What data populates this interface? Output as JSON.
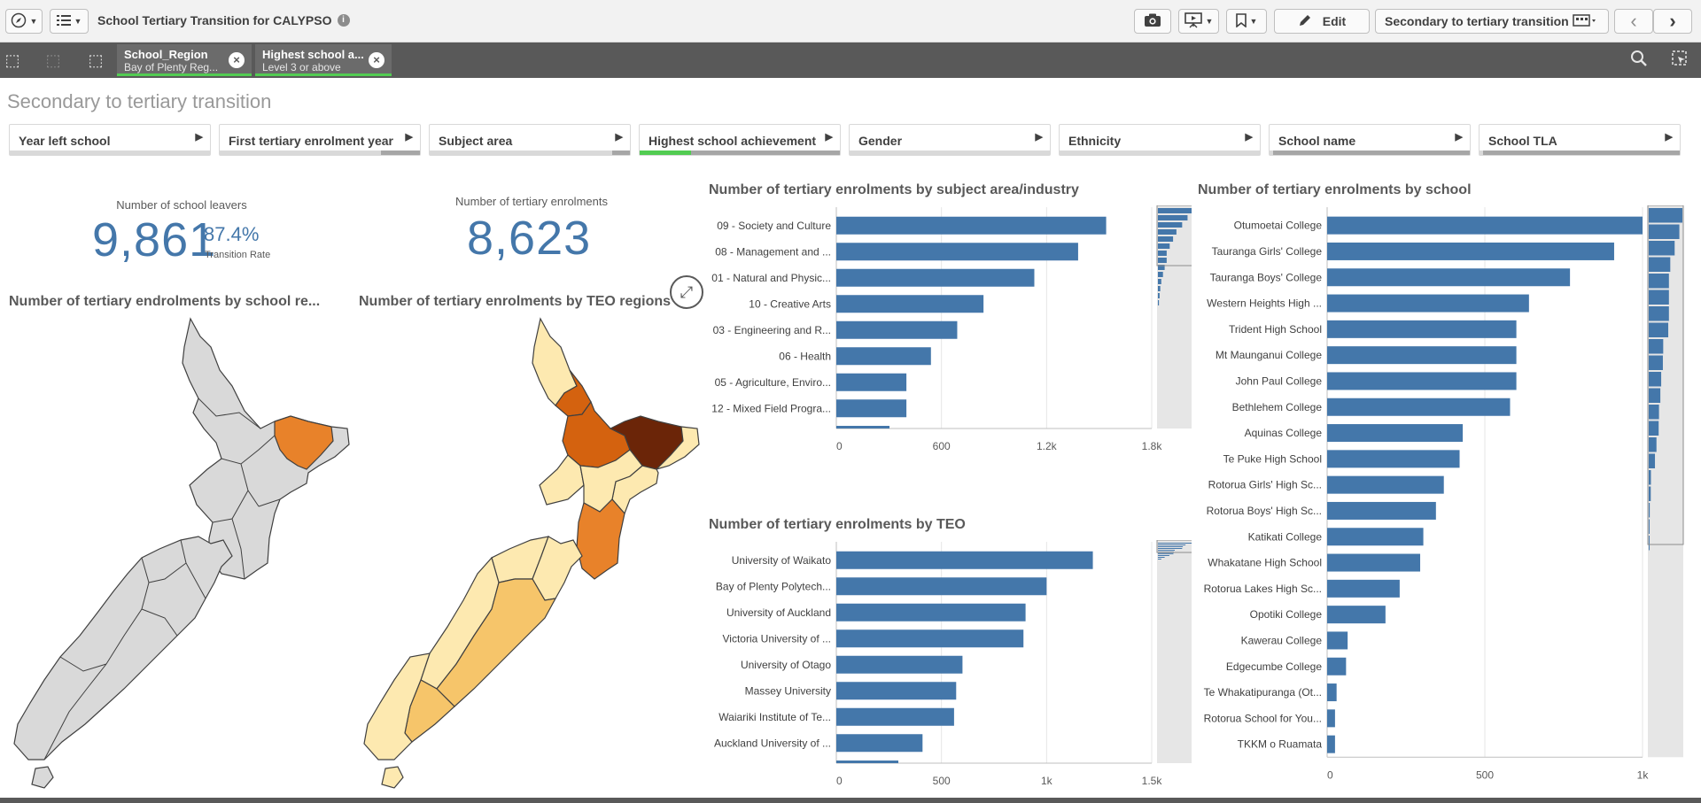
{
  "app": {
    "title": "School Tertiary Transition for CALYPSO",
    "edit_label": "Edit",
    "sheet_name": "Secondary to tertiary transition"
  },
  "selections": [
    {
      "field": "School_Region",
      "value": "Bay of Plenty Reg..."
    },
    {
      "field": "Highest school a...",
      "value": "Level 3 or above"
    }
  ],
  "sheet": {
    "title": "Secondary to tertiary transition"
  },
  "filters": [
    {
      "label": "Year left school"
    },
    {
      "label": "First tertiary enrolment year"
    },
    {
      "label": "Subject area"
    },
    {
      "label": "Highest school achievement"
    },
    {
      "label": "Gender"
    },
    {
      "label": "Ethnicity"
    },
    {
      "label": "School name"
    },
    {
      "label": "School TLA"
    }
  ],
  "kpi": {
    "leavers_label": "Number of school leavers",
    "leavers_value": "9,861",
    "rate_value": "87.4%",
    "rate_label": "Transition Rate",
    "enrolments_label": "Number of tertiary enrolments",
    "enrolments_value": "8,623"
  },
  "maps": {
    "school_region_title": "Number of tertiary endrolments by school re...",
    "teo_region_title": "Number of tertiary enrolments by TEO regions",
    "colors": {
      "grey": "#d9d9d9",
      "highlight": "#e8822a",
      "light": "#fde9b0",
      "mid": "#f6c56a",
      "dark": "#d4620f",
      "darkest": "#6b2508"
    }
  },
  "chart_data": [
    {
      "type": "bar",
      "orientation": "horizontal",
      "title": "Number of tertiary enrolments by subject area/industry",
      "categories": [
        "09 - Society and Culture",
        "08 - Management and ...",
        "01 - Natural and Physic...",
        "10 - Creative Arts",
        "03 - Engineering and R...",
        "06 - Health",
        "05 - Agriculture, Enviro...",
        "12 - Mixed Field Progra..."
      ],
      "values": [
        1540,
        1380,
        1130,
        840,
        690,
        540,
        400,
        400
      ],
      "tick_labels": [
        "0",
        "600",
        "1.2k",
        "1.8k"
      ],
      "xlim": [
        0,
        1800
      ],
      "color": "#4477aa"
    },
    {
      "type": "bar",
      "orientation": "horizontal",
      "title": "Number of tertiary enrolments by TEO",
      "categories": [
        "University of Waikato",
        "Bay of Plenty Polytech...",
        "University of Auckland",
        "Victoria University of ...",
        "University of Otago",
        "Massey University",
        "Waiariki Institute of Te...",
        "Auckland University of ..."
      ],
      "values": [
        1220,
        1000,
        900,
        890,
        600,
        570,
        560,
        410
      ],
      "tick_labels": [
        "0",
        "500",
        "1k",
        "1.5k"
      ],
      "xlim": [
        0,
        1500
      ],
      "color": "#4477aa"
    },
    {
      "type": "bar",
      "orientation": "horizontal",
      "title": "Number of tertiary enrolments by school",
      "categories": [
        "Otumoetai College",
        "Tauranga Girls' College",
        "Tauranga Boys' College",
        "Western Heights High ...",
        "Trident High School",
        "Mt Maunganui College",
        "John Paul College",
        "Bethlehem College",
        "Aquinas College",
        "Te Puke High School",
        "Rotorua Girls' High Sc...",
        "Rotorua Boys' High Sc...",
        "Katikati College",
        "Whakatane High School",
        "Rotorua Lakes High Sc...",
        "Opotiki College",
        "Kawerau College",
        "Edgecumbe College",
        "Te Whakatipuranga (Ot...",
        "Rotorua School for You...",
        "TKKM o Ruamata"
      ],
      "values": [
        1000,
        910,
        770,
        640,
        600,
        600,
        600,
        580,
        430,
        420,
        370,
        345,
        305,
        295,
        230,
        185,
        65,
        60,
        30,
        25,
        25
      ],
      "tick_labels": [
        "0",
        "500",
        "1k"
      ],
      "xlim": [
        0,
        1000
      ],
      "color": "#4477aa"
    }
  ]
}
